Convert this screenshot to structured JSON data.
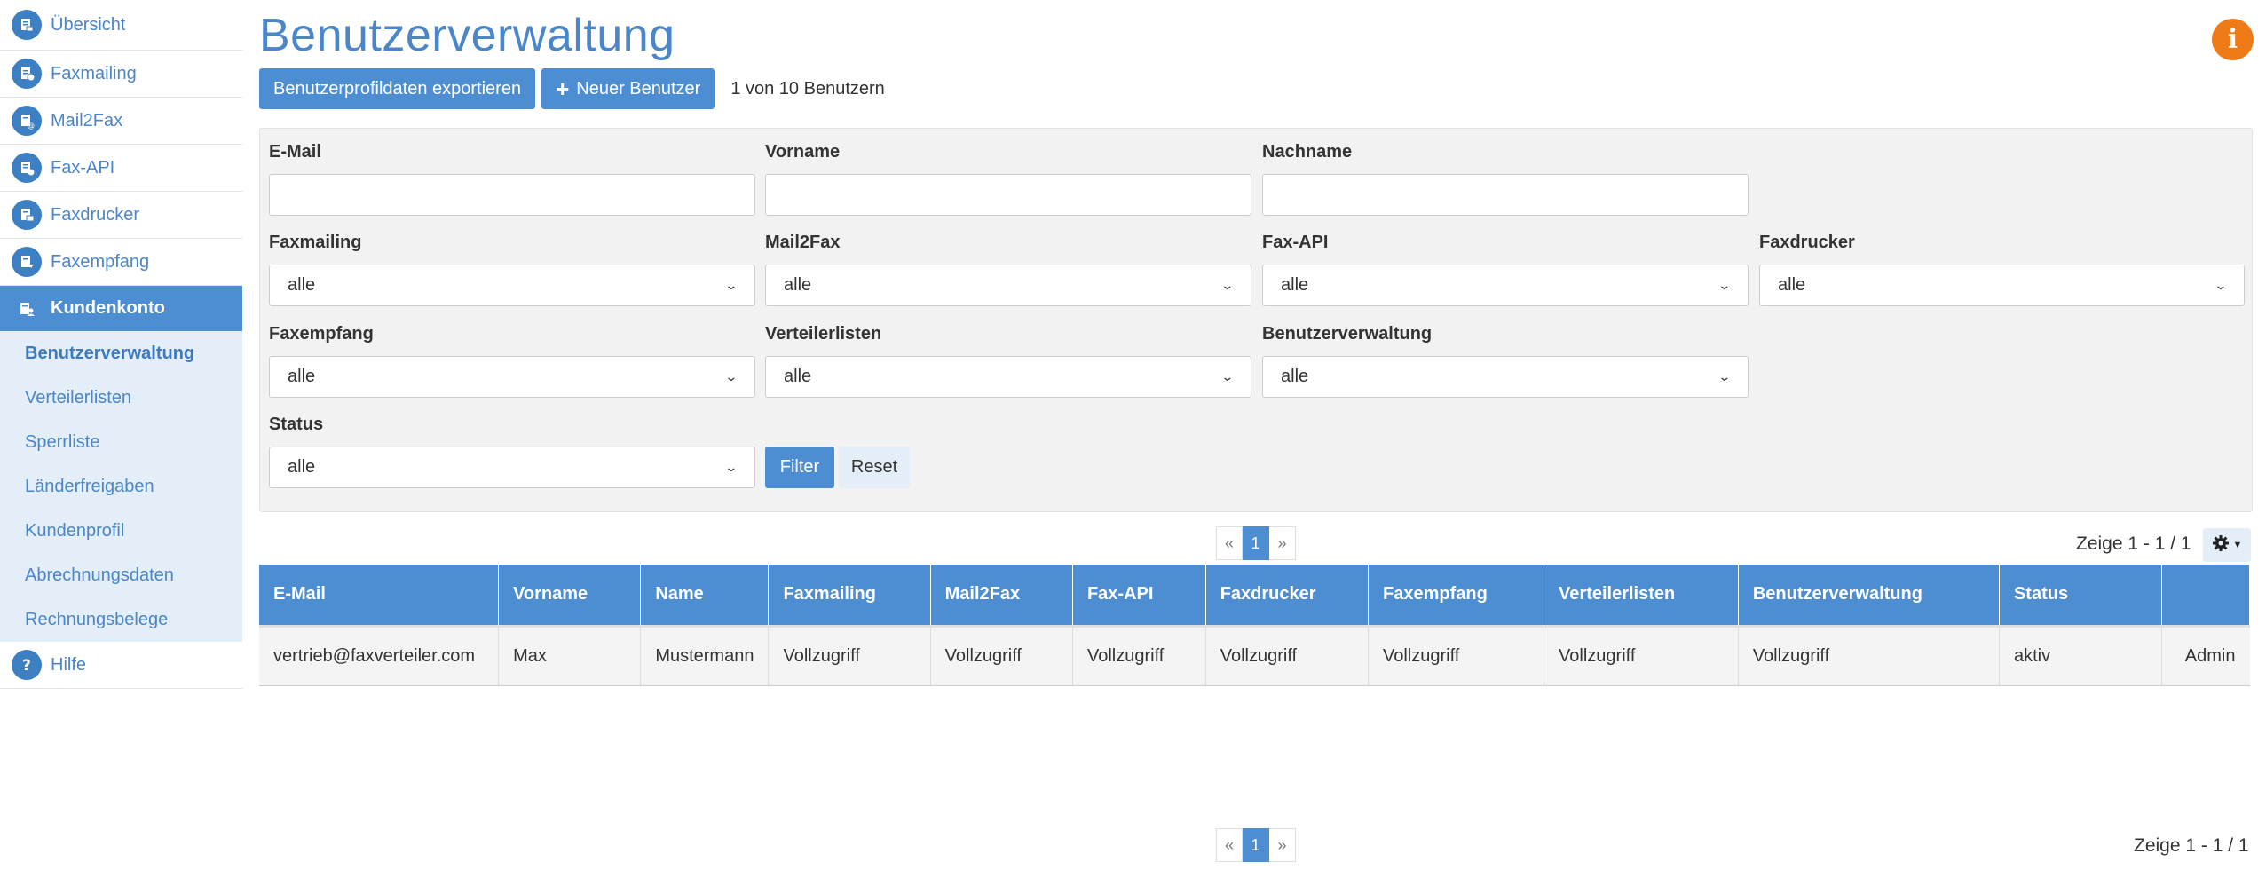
{
  "sidebar": {
    "items": [
      {
        "label": "Übersicht",
        "icon": "overview-icon"
      },
      {
        "label": "Faxmailing",
        "icon": "faxmailing-icon"
      },
      {
        "label": "Mail2Fax",
        "icon": "mail2fax-icon"
      },
      {
        "label": "Fax-API",
        "icon": "fax-api-icon"
      },
      {
        "label": "Faxdrucker",
        "icon": "faxdrucker-icon"
      },
      {
        "label": "Faxempfang",
        "icon": "faxempfang-icon"
      },
      {
        "label": "Kundenkonto",
        "icon": "kundenkonto-icon"
      }
    ],
    "subitems": [
      "Benutzerverwaltung",
      "Verteilerlisten",
      "Sperrliste",
      "Länderfreigaben",
      "Kundenprofil",
      "Abrechnungsdaten",
      "Rechnungsbelege"
    ],
    "help": "Hilfe"
  },
  "page": {
    "title": "Benutzerverwaltung",
    "export_button": "Benutzerprofildaten exportieren",
    "new_user_button": "Neuer Benutzer",
    "user_count": "1 von 10 Benutzern"
  },
  "filters": {
    "email_label": "E-Mail",
    "email_value": "",
    "vorname_label": "Vorname",
    "vorname_value": "",
    "nachname_label": "Nachname",
    "nachname_value": "",
    "faxmailing_label": "Faxmailing",
    "faxmailing_value": "alle",
    "mail2fax_label": "Mail2Fax",
    "mail2fax_value": "alle",
    "faxapi_label": "Fax-API",
    "faxapi_value": "alle",
    "faxdrucker_label": "Faxdrucker",
    "faxdrucker_value": "alle",
    "faxempfang_label": "Faxempfang",
    "faxempfang_value": "alle",
    "verteilerlisten_label": "Verteilerlisten",
    "verteilerlisten_value": "alle",
    "benutzerverwaltung_label": "Benutzerverwaltung",
    "benutzerverwaltung_value": "alle",
    "status_label": "Status",
    "status_value": "alle",
    "filter_button": "Filter",
    "reset_button": "Reset"
  },
  "pagination": {
    "prev": "«",
    "current": "1",
    "next": "»",
    "showing": "Zeige 1 - 1 / 1"
  },
  "table": {
    "headers": [
      "E-Mail",
      "Vorname",
      "Name",
      "Faxmailing",
      "Mail2Fax",
      "Fax-API",
      "Faxdrucker",
      "Faxempfang",
      "Verteilerlisten",
      "Benutzerverwaltung",
      "Status",
      ""
    ],
    "rows": [
      [
        "vertrieb@faxverteiler.com",
        "Max",
        "Mustermann",
        "Vollzugriff",
        "Vollzugriff",
        "Vollzugriff",
        "Vollzugriff",
        "Vollzugriff",
        "Vollzugriff",
        "Vollzugriff",
        "aktiv",
        "Admin"
      ]
    ]
  },
  "colors": {
    "accent": "#4d8ed3",
    "title": "#4a86c8",
    "info": "#ee7b17",
    "panel": "#f2f2f2"
  }
}
